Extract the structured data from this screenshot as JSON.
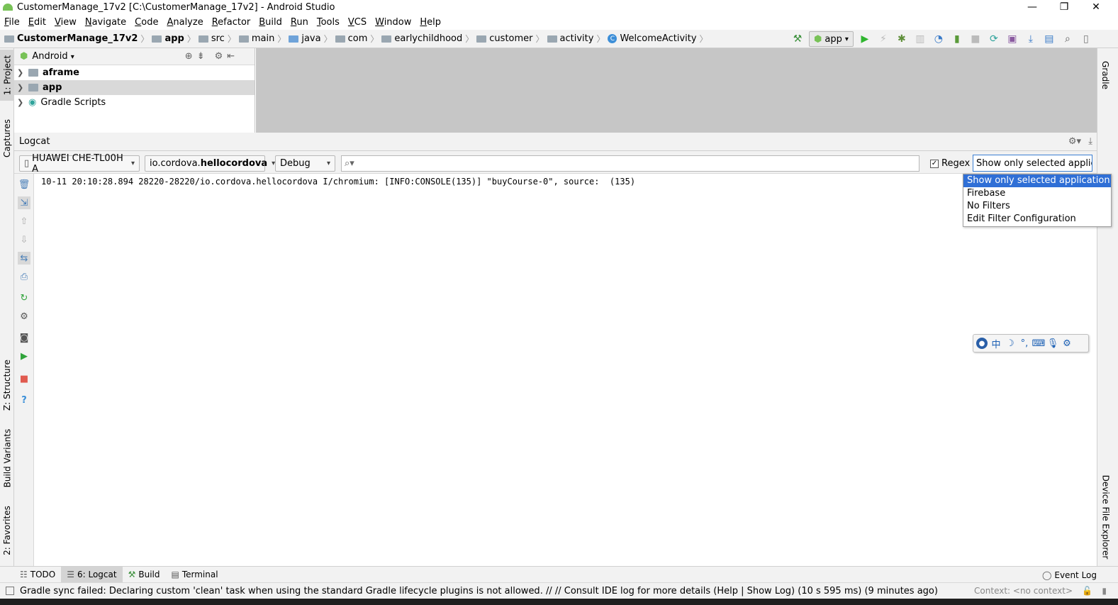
{
  "window": {
    "title": "CustomerManage_17v2 [C:\\CustomerManage_17v2] - Android Studio",
    "minimize": "—",
    "restore": "❐",
    "close": "✕"
  },
  "menu": [
    "File",
    "Edit",
    "View",
    "Navigate",
    "Code",
    "Analyze",
    "Refactor",
    "Build",
    "Run",
    "Tools",
    "VCS",
    "Window",
    "Help"
  ],
  "breadcrumbs": [
    "CustomerManage_17v2",
    "app",
    "src",
    "main",
    "java",
    "com",
    "earlychildhood",
    "customer",
    "activity",
    "WelcomeActivity"
  ],
  "toolbar": {
    "run_config": "app"
  },
  "left_tabs": {
    "project": "1: Project",
    "captures": "Captures",
    "structure": "Z: Structure",
    "build_variants": "Build Variants",
    "favorites": "2: Favorites"
  },
  "right_tabs": {
    "gradle": "Gradle",
    "device_file_explorer": "Device File Explorer"
  },
  "project": {
    "view": "Android",
    "tree": [
      {
        "label": "aframe",
        "bold": true
      },
      {
        "label": "app",
        "bold": true,
        "selected": true
      },
      {
        "label": "Gradle Scripts",
        "bold": false
      }
    ]
  },
  "logcat": {
    "title": "Logcat",
    "device": "HUAWEI CHE-TL00H A",
    "process_prefix": "io.cordova.",
    "process_bold": "hellocordova",
    "level": "Debug",
    "search_value": "",
    "regex_label": "Regex",
    "regex_checked": true,
    "filter_selected": "Show only selected applic",
    "filter_options": [
      "Show only selected application",
      "Firebase",
      "No Filters",
      "Edit Filter Configuration"
    ],
    "lines": [
      "10-11 20:10:28.894 28220-28220/io.cordova.hellocordova I/chromium: [INFO:CONSOLE(135)] \"buyCourse-0\", source:  (135)"
    ]
  },
  "bottom_tabs": [
    {
      "label": "TODO"
    },
    {
      "label": "6: Logcat",
      "active": true
    },
    {
      "label": "Build"
    },
    {
      "label": "Terminal"
    }
  ],
  "event_log": "Event Log",
  "status": {
    "message": "Gradle sync failed: Declaring custom 'clean' task when using the standard Gradle lifecycle plugins is not allowed. // // Consult IDE log for more details (Help | Show Log) (10 s 595 ms) (9 minutes ago)",
    "context": "Context: <no context>"
  },
  "colors": {
    "accent": "#2f6fd6",
    "android_green": "#78c257",
    "run_green": "#2fb52f",
    "stop_red": "#e05a4f"
  }
}
